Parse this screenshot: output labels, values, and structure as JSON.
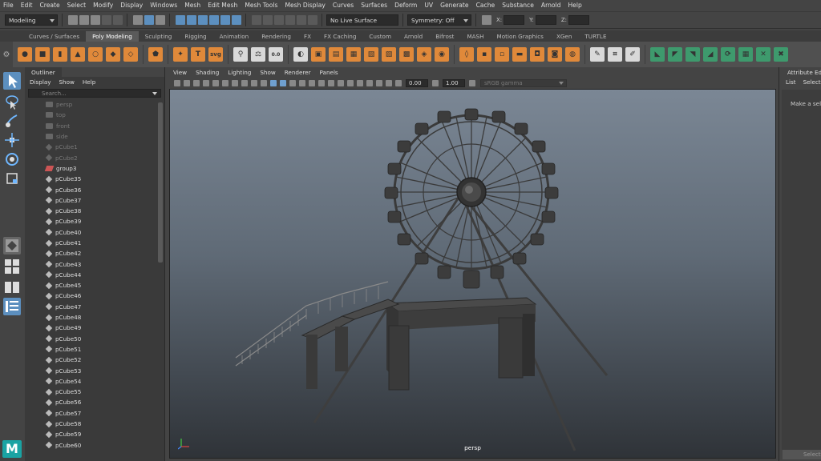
{
  "menubar": [
    "File",
    "Edit",
    "Create",
    "Select",
    "Modify",
    "Display",
    "Windows",
    "Mesh",
    "Edit Mesh",
    "Mesh Tools",
    "Mesh Display",
    "Curves",
    "Surfaces",
    "Deform",
    "UV",
    "Generate",
    "Cache",
    "Substance",
    "Arnold",
    "Help"
  ],
  "statusline": {
    "mode": "Modeling",
    "live_surface": "No Live Surface",
    "symmetry": "Symmetry: Off",
    "x_label": "X:",
    "y_label": "Y:",
    "z_label": "Z:"
  },
  "shelf_tabs": [
    "Curves / Surfaces",
    "Poly Modeling",
    "Sculpting",
    "Rigging",
    "Animation",
    "Rendering",
    "FX",
    "FX Caching",
    "Custom",
    "Arnold",
    "Bifrost",
    "MASH",
    "Motion Graphics",
    "XGen",
    "TURTLE"
  ],
  "shelf_active_tab": "Poly Modeling",
  "shelf_icons": {
    "svg_label": "svg",
    "text_label": "T",
    "coord_label": "0.0"
  },
  "outliner": {
    "title": "Outliner",
    "menu": [
      "Display",
      "Show",
      "Help"
    ],
    "search_placeholder": "Search...",
    "items": [
      {
        "label": "persp",
        "type": "cam",
        "dim": true
      },
      {
        "label": "top",
        "type": "cam",
        "dim": true
      },
      {
        "label": "front",
        "type": "cam",
        "dim": true
      },
      {
        "label": "side",
        "type": "cam",
        "dim": true
      },
      {
        "label": "pCube1",
        "type": "mesh",
        "dim": true
      },
      {
        "label": "pCube2",
        "type": "mesh",
        "dim": true
      },
      {
        "label": "group3",
        "type": "grp",
        "dim": false
      },
      {
        "label": "pCube35",
        "type": "mesh",
        "dim": false
      },
      {
        "label": "pCube36",
        "type": "mesh",
        "dim": false
      },
      {
        "label": "pCube37",
        "type": "mesh",
        "dim": false
      },
      {
        "label": "pCube38",
        "type": "mesh",
        "dim": false
      },
      {
        "label": "pCube39",
        "type": "mesh",
        "dim": false
      },
      {
        "label": "pCube40",
        "type": "mesh",
        "dim": false
      },
      {
        "label": "pCube41",
        "type": "mesh",
        "dim": false
      },
      {
        "label": "pCube42",
        "type": "mesh",
        "dim": false
      },
      {
        "label": "pCube43",
        "type": "mesh",
        "dim": false
      },
      {
        "label": "pCube44",
        "type": "mesh",
        "dim": false
      },
      {
        "label": "pCube45",
        "type": "mesh",
        "dim": false
      },
      {
        "label": "pCube46",
        "type": "mesh",
        "dim": false
      },
      {
        "label": "pCube47",
        "type": "mesh",
        "dim": false
      },
      {
        "label": "pCube48",
        "type": "mesh",
        "dim": false
      },
      {
        "label": "pCube49",
        "type": "mesh",
        "dim": false
      },
      {
        "label": "pCube50",
        "type": "mesh",
        "dim": false
      },
      {
        "label": "pCube51",
        "type": "mesh",
        "dim": false
      },
      {
        "label": "pCube52",
        "type": "mesh",
        "dim": false
      },
      {
        "label": "pCube53",
        "type": "mesh",
        "dim": false
      },
      {
        "label": "pCube54",
        "type": "mesh",
        "dim": false
      },
      {
        "label": "pCube55",
        "type": "mesh",
        "dim": false
      },
      {
        "label": "pCube56",
        "type": "mesh",
        "dim": false
      },
      {
        "label": "pCube57",
        "type": "mesh",
        "dim": false
      },
      {
        "label": "pCube58",
        "type": "mesh",
        "dim": false
      },
      {
        "label": "pCube59",
        "type": "mesh",
        "dim": false
      },
      {
        "label": "pCube60",
        "type": "mesh",
        "dim": false
      }
    ]
  },
  "viewport": {
    "menu": [
      "View",
      "Shading",
      "Lighting",
      "Show",
      "Renderer",
      "Panels"
    ],
    "field1": "0.00",
    "field2": "1.00",
    "color_space": "sRGB gamma",
    "camera_label": "persp"
  },
  "attribute_editor": {
    "title": "Attribute Editor",
    "menu": [
      "List",
      "Selected"
    ],
    "message": "Make a selection",
    "button": "Select"
  },
  "colors": {
    "accent_orange": "#e0893a",
    "accent_blue": "#5c8fbf",
    "maya_logo": "#1aa3a3"
  }
}
